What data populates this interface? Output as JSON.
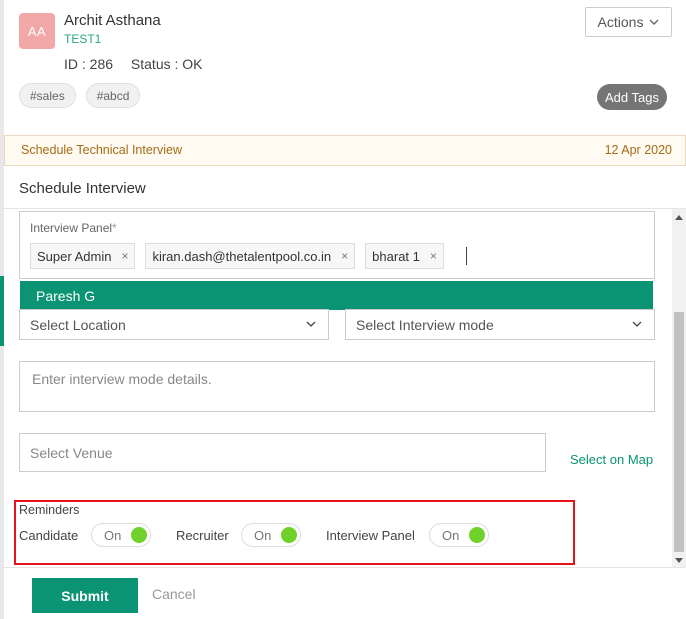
{
  "candidate": {
    "initials": "AA",
    "name": "Archit Asthana",
    "subtitle": "TEST1",
    "id_text": "ID : 286",
    "status_text": "Status : OK",
    "tags": [
      "#sales",
      "#abcd"
    ],
    "actions_label": "Actions",
    "add_tags_label": "Add Tags"
  },
  "stage": {
    "title": "Schedule Technical Interview",
    "date": "12 Apr 2020"
  },
  "modal": {
    "title": "Schedule Interview",
    "panel": {
      "label": "Interview Panel",
      "required_mark": "*",
      "chips": [
        "Super Admin",
        "kiran.dash@thetalentpool.co.in",
        "bharat 1"
      ],
      "remove_glyph": "×",
      "suggestion": "Paresh G"
    },
    "location_placeholder": "Select Location",
    "mode_placeholder": "Select Interview mode",
    "mode_details_placeholder": "Enter interview mode details.",
    "venue_placeholder": "Select Venue",
    "map_link": "Select on Map",
    "reminders": {
      "title": "Reminders",
      "items": [
        {
          "label": "Candidate",
          "state": "On"
        },
        {
          "label": "Recruiter",
          "state": "On"
        },
        {
          "label": "Interview Panel",
          "state": "On"
        }
      ]
    },
    "submit_label": "Submit",
    "cancel_label": "Cancel"
  },
  "colors": {
    "brand_green": "#0b9474",
    "toggle_on": "#6fd12a",
    "highlight_red": "#e4141c",
    "stage_text": "#a46c16",
    "avatar_bg": "#f3a8a8"
  }
}
